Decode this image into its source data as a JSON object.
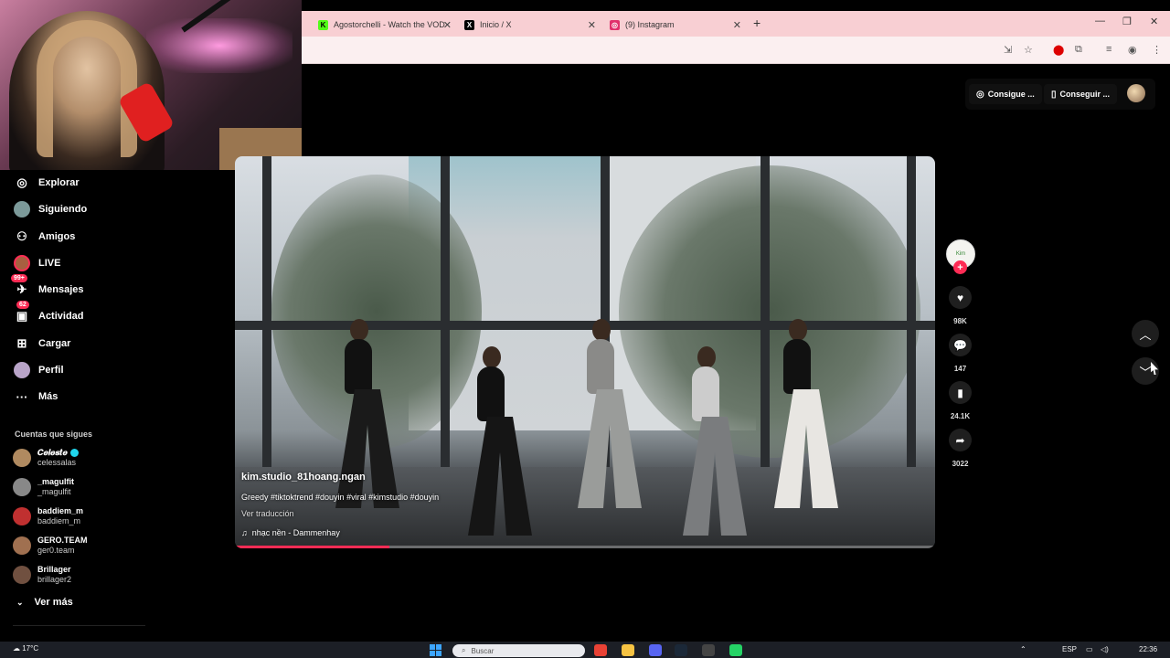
{
  "browser": {
    "tabs": [
      {
        "title": "Agostorchelli - Watch the VOD",
        "icon": "kick-icon",
        "color": "#53fc18"
      },
      {
        "title": "Inicio / X",
        "icon": "x-icon",
        "color": "#000000"
      },
      {
        "title": "(9) Instagram",
        "icon": "instagram-icon",
        "color": "#e1306c"
      }
    ],
    "new_tab": "+",
    "window_controls": {
      "minimize": "—",
      "restore": "❐",
      "close": "✕"
    }
  },
  "sidebar": {
    "items": [
      {
        "label": "Explorar",
        "icon": "compass-icon",
        "glyph": "◎"
      },
      {
        "label": "Siguiendo",
        "icon": "following-avatar-icon",
        "glyph": "●"
      },
      {
        "label": "Amigos",
        "icon": "friends-icon",
        "glyph": "👥"
      },
      {
        "label": "LIVE",
        "icon": "live-icon",
        "glyph": "●"
      },
      {
        "label": "Mensajes",
        "icon": "messages-icon",
        "glyph": "✈",
        "badge": "99+"
      },
      {
        "label": "Actividad",
        "icon": "activity-icon",
        "glyph": "▣",
        "badge": "62"
      },
      {
        "label": "Cargar",
        "icon": "upload-icon",
        "glyph": "⊞"
      },
      {
        "label": "Perfil",
        "icon": "profile-icon",
        "glyph": "●"
      },
      {
        "label": "Más",
        "icon": "more-icon",
        "glyph": "···"
      }
    ],
    "following_title": "Cuentas que sigues",
    "following": [
      {
        "name": "𝑪𝒆𝒍𝒆𝒔𝒕𝒆",
        "handle": "celessalas",
        "verified": true,
        "color": "#b08a60"
      },
      {
        "name": "_magulfit",
        "handle": "_magulfit",
        "verified": false,
        "color": "#888888"
      },
      {
        "name": "baddiem_m",
        "handle": "baddiem_m",
        "verified": false,
        "color": "#c03030"
      },
      {
        "name": "GERO.TEAM",
        "handle": "ger0.team",
        "verified": false,
        "color": "#a07050"
      },
      {
        "name": "Brillager",
        "handle": "brillager2",
        "verified": false,
        "color": "#705040"
      }
    ],
    "see_more": "Ver más"
  },
  "topbar": {
    "coins_label": "Consigue ...",
    "app_label": "Conseguir ..."
  },
  "video": {
    "username": "kim.studio_81hoang.ngan",
    "description": "Greedy #tiktoktrend #douyin #viral  #kimstudio #douyin",
    "translate": "Ver traducción",
    "music": "nhạc nền - Dammenhay",
    "progress": 0.22
  },
  "actions": {
    "creator_avatar_text": "Kim",
    "likes": "98K",
    "comments": "147",
    "saves": "24.1K",
    "shares": "3022"
  },
  "taskbar": {
    "temperature": "17°C",
    "search_placeholder": "Buscar",
    "language": "ESP",
    "time": "22:36"
  }
}
